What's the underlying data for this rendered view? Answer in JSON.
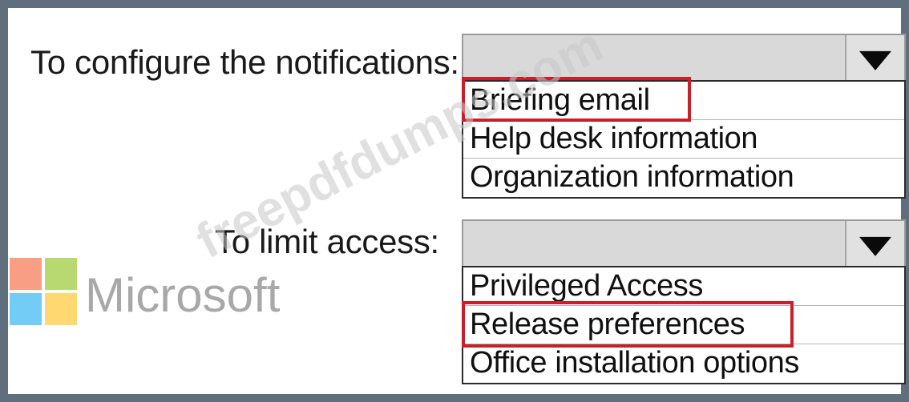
{
  "questions": [
    {
      "label": "To configure the notifications:",
      "options": [
        "Briefing email",
        "Help desk information",
        "Organization information"
      ],
      "highlighted_option": "Briefing email"
    },
    {
      "label": "To limit access:",
      "options": [
        "Privileged Access",
        "Release preferences",
        "Office installation options"
      ],
      "highlighted_option": "Release preferences"
    }
  ],
  "branding": {
    "logo_text": "Microsoft",
    "logo_colors": [
      "#f25022",
      "#7fba00",
      "#00a4ef",
      "#ffb900"
    ]
  },
  "watermark": {
    "text": "freepdfdumps.com"
  },
  "colors": {
    "highlight": "#c8202a",
    "frame": "#5f6f7e"
  }
}
